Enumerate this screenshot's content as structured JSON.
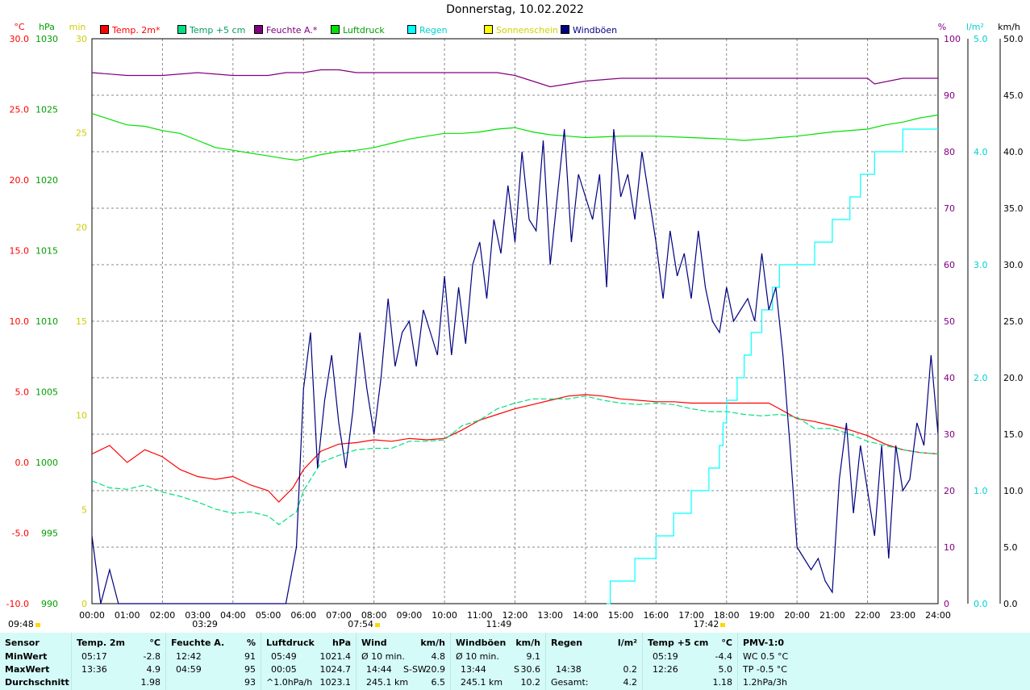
{
  "title": "Donnerstag, 10.02.2022",
  "axes": {
    "left_units": [
      {
        "text": "°C",
        "color": "#ff0000"
      },
      {
        "text": "hPa",
        "color": "#00a000"
      },
      {
        "text": "min",
        "color": "#cccc00"
      }
    ],
    "right_units": [
      {
        "text": "%",
        "color": "#800080"
      },
      {
        "text": "l/m²",
        "color": "#00d0d0"
      },
      {
        "text": "km/h",
        "color": "#000000"
      }
    ],
    "temp_ticks": [
      "30.0",
      "25.0",
      "20.0",
      "15.0",
      "10.0",
      "5.0",
      "0.0",
      "-5.0",
      "-10.0"
    ],
    "pressure_ticks": [
      "1030",
      "1025",
      "1020",
      "1015",
      "1010",
      "1005",
      "1000",
      "995",
      "990"
    ],
    "sun_ticks": [
      "30",
      "25",
      "20",
      "15",
      "10",
      "5",
      "0"
    ],
    "humidity_ticks": [
      "100",
      "90",
      "80",
      "70",
      "60",
      "50",
      "40",
      "30",
      "20",
      "10",
      "0"
    ],
    "rain_ticks": [
      "5.0",
      "4.0",
      "3.0",
      "2.0",
      "1.0",
      "0.0"
    ],
    "wind_ticks": [
      "50.0",
      "45.0",
      "40.0",
      "35.0",
      "30.0",
      "25.0",
      "20.0",
      "15.0",
      "10.0",
      "5.0",
      "0.0"
    ],
    "time_ticks": [
      "00:00",
      "01:00",
      "02:00",
      "03:00",
      "04:00",
      "05:00",
      "06:00",
      "07:00",
      "08:00",
      "09:00",
      "10:00",
      "11:00",
      "12:00",
      "13:00",
      "14:00",
      "15:00",
      "16:00",
      "17:00",
      "18:00",
      "19:00",
      "20:00",
      "21:00",
      "22:00",
      "23:00",
      "24:00"
    ]
  },
  "legend": [
    {
      "label": "Temp. 2m*",
      "color": "#ff0000",
      "text_color": "#ff0000"
    },
    {
      "label": "Temp +5 cm",
      "color": "#00e080",
      "text_color": "#00a060"
    },
    {
      "label": "Feuchte A.*",
      "color": "#800080",
      "text_color": "#800080"
    },
    {
      "label": "Luftdruck",
      "color": "#00e000",
      "text_color": "#00a000"
    },
    {
      "label": "Regen",
      "color": "#00ffff",
      "text_color": "#00d0d0"
    },
    {
      "label": "Sonnenschein",
      "color": "#ffff00",
      "text_color": "#d0d000"
    },
    {
      "label": "Windböen",
      "color": "#000080",
      "text_color": "#000080"
    }
  ],
  "events": [
    {
      "label": "09:48",
      "hour": 0,
      "sun": true
    },
    {
      "label": "03:29",
      "hour": 3.483
    },
    {
      "label": "07:54",
      "hour": 7.9,
      "sun": true
    },
    {
      "label": "11:49",
      "hour": 11.817
    },
    {
      "label": "17:42",
      "hour": 17.7,
      "sun": true
    }
  ],
  "chart_data": {
    "type": "line",
    "title": "Donnerstag, 10.02.2022",
    "x_unit": "hour of day",
    "xlim": [
      0,
      24
    ],
    "series": [
      {
        "name": "Temp. 2m*",
        "axis": "°C",
        "ylim": [
          -10,
          30
        ],
        "color": "#ff0000",
        "x": [
          0,
          0.5,
          1,
          1.5,
          2,
          2.5,
          3,
          3.5,
          4,
          4.5,
          5,
          5.3,
          5.7,
          6,
          6.5,
          7,
          7.5,
          8,
          8.5,
          9,
          9.5,
          10,
          10.5,
          11,
          11.5,
          12,
          12.5,
          13,
          13.5,
          14,
          14.5,
          15,
          15.5,
          16,
          16.5,
          17,
          17.5,
          18,
          18.5,
          19,
          19.2,
          19.5,
          20,
          20.5,
          21,
          21.5,
          22,
          22.5,
          23,
          23.5,
          24
        ],
        "y": [
          0.6,
          1.2,
          0.0,
          0.9,
          0.4,
          -0.5,
          -1.0,
          -1.2,
          -1.0,
          -1.6,
          -2.0,
          -2.8,
          -1.8,
          -0.5,
          0.8,
          1.3,
          1.4,
          1.6,
          1.5,
          1.7,
          1.6,
          1.7,
          2.3,
          3.0,
          3.4,
          3.8,
          4.1,
          4.4,
          4.7,
          4.8,
          4.7,
          4.5,
          4.4,
          4.3,
          4.3,
          4.2,
          4.2,
          4.2,
          4.2,
          4.2,
          4.2,
          3.8,
          3.1,
          2.9,
          2.6,
          2.3,
          1.9,
          1.3,
          0.9,
          0.7,
          0.6
        ]
      },
      {
        "name": "Temp +5 cm",
        "axis": "°C",
        "ylim": [
          -10,
          30
        ],
        "color": "#00e080",
        "x": [
          0,
          0.5,
          1,
          1.5,
          2,
          2.5,
          3,
          3.5,
          4,
          4.5,
          5,
          5.3,
          5.8,
          6,
          6.5,
          7,
          7.5,
          8,
          8.5,
          9,
          9.5,
          10,
          10.5,
          11,
          11.5,
          12,
          12.5,
          13,
          13.5,
          14,
          14.5,
          15,
          15.5,
          16,
          16.5,
          17,
          17.5,
          18,
          18.5,
          19,
          19.5,
          20,
          20.5,
          21,
          21.5,
          22,
          22.5,
          23,
          23.5,
          24
        ],
        "y": [
          -1.3,
          -1.8,
          -1.9,
          -1.6,
          -2.1,
          -2.4,
          -2.8,
          -3.3,
          -3.6,
          -3.5,
          -3.8,
          -4.4,
          -3.5,
          -2.0,
          0.0,
          0.5,
          0.9,
          1.0,
          1.0,
          1.5,
          1.5,
          1.6,
          2.6,
          3.0,
          3.8,
          4.2,
          4.5,
          4.5,
          4.5,
          4.7,
          4.4,
          4.2,
          4.1,
          4.2,
          4.1,
          3.8,
          3.6,
          3.6,
          3.4,
          3.3,
          3.4,
          3.2,
          2.4,
          2.4,
          2.0,
          1.5,
          1.2,
          0.9,
          0.7,
          0.6
        ]
      },
      {
        "name": "Feuchte A.*",
        "axis": "%",
        "ylim": [
          0,
          100
        ],
        "color": "#800080",
        "x": [
          0,
          1,
          2,
          3,
          4,
          5,
          5.5,
          6,
          6.5,
          7,
          7.5,
          8,
          9,
          10,
          11,
          11.5,
          12,
          12.5,
          13,
          13.5,
          14,
          15,
          16,
          17,
          18,
          19,
          20,
          21,
          22,
          22.2,
          23,
          24
        ],
        "y": [
          94,
          93.5,
          93.5,
          94,
          93.5,
          93.5,
          94,
          94,
          94.5,
          94.5,
          94,
          94,
          94,
          94,
          94,
          94,
          93.5,
          92.5,
          91.5,
          92,
          92.5,
          93,
          93,
          93,
          93,
          93,
          93,
          93,
          93,
          92,
          93,
          93
        ]
      },
      {
        "name": "Luftdruck",
        "axis": "hPa",
        "ylim": [
          990,
          1030
        ],
        "color": "#00e000",
        "x": [
          0,
          0.5,
          1,
          1.5,
          2,
          2.5,
          3,
          3.5,
          4,
          4.5,
          5,
          5.5,
          5.8,
          6,
          6.5,
          7,
          7.5,
          8,
          8.5,
          9,
          9.5,
          10,
          10.5,
          11,
          11.5,
          12,
          12.5,
          13,
          13.5,
          14,
          15,
          16,
          17,
          18,
          18.5,
          19,
          19.5,
          20,
          21,
          22,
          22.5,
          23,
          23.5,
          24
        ],
        "y": [
          1024.7,
          1024.3,
          1023.9,
          1023.8,
          1023.5,
          1023.3,
          1022.8,
          1022.3,
          1022.1,
          1021.9,
          1021.7,
          1021.5,
          1021.4,
          1021.5,
          1021.8,
          1022.0,
          1022.1,
          1022.3,
          1022.6,
          1022.9,
          1023.1,
          1023.3,
          1023.3,
          1023.4,
          1023.6,
          1023.7,
          1023.4,
          1023.2,
          1023.1,
          1023.0,
          1023.1,
          1023.1,
          1023.0,
          1022.9,
          1022.8,
          1022.9,
          1023.0,
          1023.1,
          1023.4,
          1023.6,
          1023.9,
          1024.1,
          1024.4,
          1024.6
        ]
      },
      {
        "name": "Regen",
        "axis": "l/m²",
        "ylim": [
          0,
          5
        ],
        "color": "#00ffff",
        "x": [
          14.6,
          14.7,
          15.4,
          16,
          16.5,
          17,
          17.5,
          17.8,
          17.9,
          18,
          18.3,
          18.5,
          18.7,
          19,
          19.3,
          19.5,
          20.5,
          21,
          21.5,
          21.8,
          22.2,
          23,
          23.5,
          24
        ],
        "y": [
          0,
          0.2,
          0.4,
          0.6,
          0.8,
          1.0,
          1.2,
          1.4,
          1.6,
          1.8,
          2.0,
          2.2,
          2.4,
          2.6,
          2.8,
          3.0,
          3.2,
          3.4,
          3.6,
          3.8,
          4.0,
          4.2,
          4.2,
          4.2
        ]
      },
      {
        "name": "Windböen",
        "axis": "km/h",
        "ylim": [
          0,
          50
        ],
        "color": "#000080",
        "x": [
          0,
          0.25,
          0.5,
          0.75,
          1,
          1.5,
          2,
          2.5,
          3,
          3.5,
          4,
          4.5,
          5,
          5.5,
          5.8,
          6,
          6.2,
          6.4,
          6.6,
          6.8,
          7,
          7.2,
          7.4,
          7.6,
          7.8,
          8,
          8.2,
          8.4,
          8.6,
          8.8,
          9,
          9.2,
          9.4,
          9.6,
          9.8,
          10,
          10.2,
          10.4,
          10.6,
          10.8,
          11,
          11.2,
          11.4,
          11.6,
          11.8,
          12,
          12.2,
          12.4,
          12.6,
          12.8,
          13,
          13.2,
          13.4,
          13.6,
          13.8,
          14,
          14.2,
          14.4,
          14.6,
          14.8,
          15,
          15.2,
          15.4,
          15.6,
          15.8,
          16,
          16.2,
          16.4,
          16.6,
          16.8,
          17,
          17.2,
          17.4,
          17.6,
          17.8,
          18,
          18.2,
          18.4,
          18.6,
          18.8,
          19,
          19.2,
          19.4,
          19.6,
          19.8,
          20,
          20.2,
          20.4,
          20.6,
          20.8,
          21,
          21.2,
          21.4,
          21.6,
          21.8,
          22,
          22.2,
          22.4,
          22.6,
          22.8,
          23,
          23.2,
          23.4,
          23.6,
          23.8,
          24
        ],
        "y": [
          6,
          0,
          3,
          0,
          0,
          0,
          0,
          0,
          0,
          0,
          0,
          0,
          0,
          0,
          5,
          19,
          24,
          12,
          18,
          22,
          16,
          12,
          17,
          24,
          19,
          15,
          20,
          27,
          21,
          24,
          25,
          21,
          26,
          24,
          22,
          29,
          22,
          28,
          23,
          30,
          32,
          27,
          34,
          31,
          37,
          32,
          40,
          34,
          33,
          41,
          30,
          36,
          42,
          32,
          38,
          36,
          34,
          38,
          28,
          42,
          36,
          38,
          34,
          40,
          36,
          32,
          27,
          33,
          29,
          31,
          27,
          33,
          28,
          25,
          24,
          28,
          25,
          26,
          27,
          25,
          31,
          26,
          28,
          22,
          14,
          5,
          4,
          3,
          4,
          2,
          1,
          11,
          16,
          8,
          14,
          10,
          6,
          14,
          4,
          14,
          10,
          11,
          16,
          14,
          22,
          15
        ]
      }
    ]
  },
  "stats": {
    "sensor": {
      "header": "Sensor",
      "rows": [
        "MinWert",
        "MaxWert",
        "Durchschnitt"
      ]
    },
    "temp2m": {
      "header": "Temp. 2m",
      "unit": "°C",
      "rows": [
        [
          "05:17",
          "-2.8"
        ],
        [
          "13:36",
          "4.9"
        ],
        [
          "",
          "1.98"
        ]
      ]
    },
    "feuchte": {
      "header": "Feuchte A.",
      "unit": "%",
      "rows": [
        [
          "12:42",
          "91"
        ],
        [
          "04:59",
          "95"
        ],
        [
          "",
          "93"
        ]
      ]
    },
    "luftdruck": {
      "header": "Luftdruck",
      "unit": "hPa",
      "rows": [
        [
          "05:49",
          "1021.4"
        ],
        [
          "00:05",
          "1024.7"
        ],
        [
          "^1.0hPa/h",
          "1023.1"
        ]
      ]
    },
    "wind": {
      "header": "Wind",
      "unit": "km/h",
      "rows": [
        [
          "Ø 10 min.",
          "",
          "4.8"
        ],
        [
          "14:44",
          "S-SW",
          "20.9"
        ],
        [
          "245.1 km",
          "",
          "6.5"
        ]
      ]
    },
    "windboeen": {
      "header": "Windböen",
      "unit": "km/h",
      "rows": [
        [
          "Ø 10 min.",
          "",
          "9.1"
        ],
        [
          "13:44",
          "S",
          "30.6"
        ],
        [
          "245.1 km",
          "",
          "10.2"
        ]
      ]
    },
    "regen": {
      "header": "Regen",
      "unit": "l/m²",
      "rows": [
        [
          "",
          ""
        ],
        [
          "14:38",
          "0.2"
        ],
        [
          "Gesamt:",
          "4.2"
        ]
      ]
    },
    "temp5cm": {
      "header": "Temp +5 cm",
      "unit": "°C",
      "rows": [
        [
          "05:19",
          "-4.4"
        ],
        [
          "12:26",
          "5.0"
        ],
        [
          "",
          "1.18"
        ]
      ]
    },
    "pmv": {
      "header": "PMV-1:0",
      "rows": [
        "WC 0.5 °C",
        "TP -0.5 °C",
        "1.2hPa/3h"
      ]
    }
  }
}
